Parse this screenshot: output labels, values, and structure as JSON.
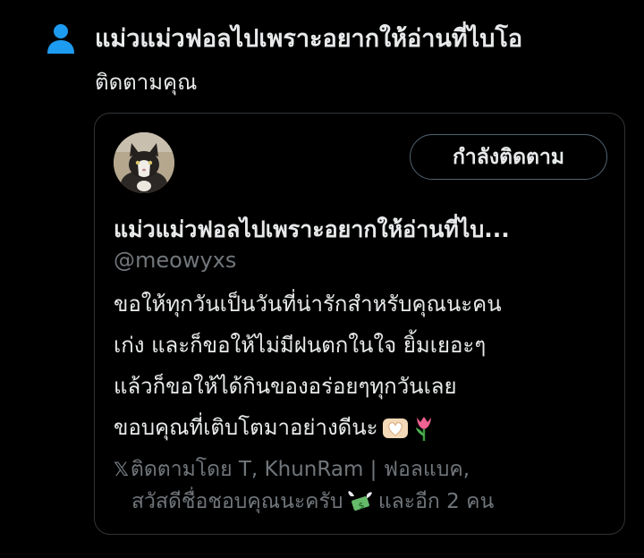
{
  "notification": {
    "icon": "person-icon",
    "actor_name": "แม่วแม่วฟอลไปเพราะอยากให้อ่านที่ไบโอ",
    "action_text": "ติดตามคุณ"
  },
  "card": {
    "follow_button_label": "กำลังติดตาม",
    "display_name": "แม่วแม่วฟอลไปเพราะอยากให้อ่านที่ไบ...",
    "handle": "@meowyxs",
    "bio_lines": [
      "ขอให้ทุกวันเป็นวันที่น่ารักสำหรับคุณนะคน",
      "เก่ง และก็ขอให้ไม่มีฝนตกในใจ ยิ้มเยอะๆ",
      "แล้วก็ขอให้ได้กินของอร่อยๆทุกวันเลย",
      "ขอบคุณที่เติบโตมาอย่างดีนะ"
    ],
    "bio_emojis": [
      "heart-hands-icon",
      "tulip-icon"
    ],
    "followed_by": {
      "logo": "𝕏",
      "line1": "ติดตามโดย T, KhunRam | ฟอลแบค,",
      "line2": "สวัสดีชื่อชอบคุณนะครับ",
      "emoji": "money-with-wings-icon",
      "suffix": "และอีก 2 คน"
    }
  },
  "colors": {
    "background": "#000000",
    "text_primary": "#e7e9ea",
    "text_secondary": "#71767b",
    "accent_blue": "#1d9bf0",
    "border": "#2f3336"
  }
}
